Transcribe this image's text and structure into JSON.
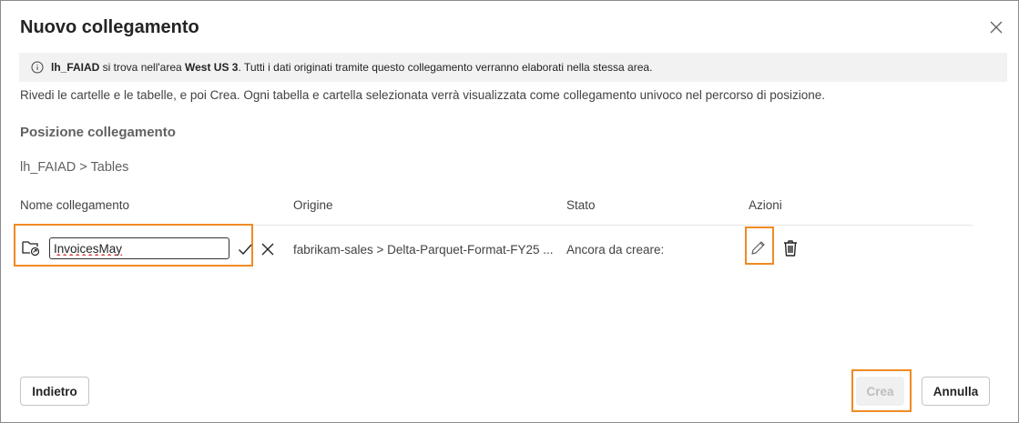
{
  "dialog": {
    "title": "Nuovo collegamento",
    "close_icon": "close-icon"
  },
  "info": {
    "icon": "info-icon",
    "lakehouse": "lh_FAIAD",
    "text_1": " si trova nell'area ",
    "region": "West US 3",
    "text_2": ". Tutti i dati originati tramite questo collegamento verranno elaborati nella stessa area."
  },
  "description": "Rivedi le cartelle e le tabelle, e poi Crea. Ogni tabella e cartella selezionata verrà visualizzata come collegamento univoco nel percorso di posizione.",
  "location": {
    "title": "Posizione collegamento",
    "breadcrumb": "lh_FAIAD > Tables"
  },
  "table": {
    "headers": {
      "name": "Nome collegamento",
      "origin": "Origine",
      "status": "Stato",
      "actions": "Azioni"
    },
    "rows": [
      {
        "name_value": "InvoicesMay",
        "origin": "fabrikam-sales > Delta-Parquet-Format-FY25 ...",
        "status": "Ancora da creare:",
        "icons": [
          "folder-link-icon",
          "checkmark-icon",
          "dismiss-icon",
          "pencil-icon",
          "trash-icon"
        ]
      }
    ]
  },
  "footer": {
    "back_label": "Indietro",
    "create_label": "Crea",
    "cancel_label": "Annulla"
  },
  "colors": {
    "highlight": "#f08a24",
    "info_bg": "#f2f2f2",
    "disabled_bg": "#f0f0f0",
    "disabled_text": "#bdbdbd"
  }
}
